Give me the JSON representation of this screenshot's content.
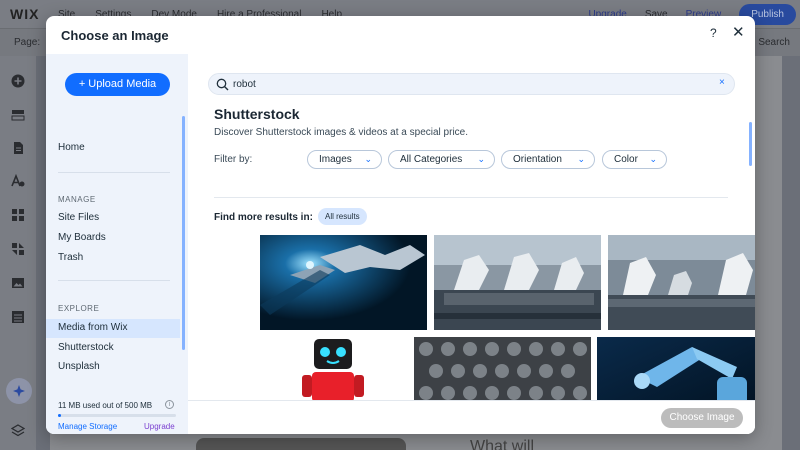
{
  "editor": {
    "logo": "WIX",
    "menu": [
      "Site",
      "Settings",
      "Dev Mode",
      "Hire a Professional",
      "Help"
    ],
    "top_right": {
      "upgrade": "Upgrade",
      "save": "Save",
      "preview": "Preview",
      "publish": "Publish"
    },
    "page_label": "Page:",
    "search_label": "Search",
    "canvas_text": "What will"
  },
  "modal": {
    "title": "Choose an Image",
    "help_glyph": "?",
    "close_glyph": "✕",
    "upload_label": "+ Upload Media",
    "sidebar": {
      "home": "Home",
      "manage_header": "MANAGE",
      "manage_items": [
        "Site Files",
        "My Boards",
        "Trash"
      ],
      "explore_header": "EXPLORE",
      "explore_items": [
        "Media from Wix",
        "Shutterstock",
        "Unsplash"
      ],
      "selected": "Shutterstock",
      "storage_text": "11 MB used out of 500 MB",
      "storage_used_fraction": 0.022,
      "manage_storage": "Manage Storage",
      "upgrade": "Upgrade",
      "info_glyph": "i"
    },
    "search": {
      "value": "robot",
      "clear_glyph": "×"
    },
    "provider": {
      "title": "Shutterstock",
      "subtitle": "Discover Shutterstock images & videos at a special price."
    },
    "filters": {
      "label": "Filter by:",
      "chips": [
        "Images",
        "All Categories",
        "Orientation",
        "Color"
      ],
      "chevron": "⌄"
    },
    "results": {
      "label": "Find more results in:",
      "all_results": "All results"
    },
    "choose_button": "Choose Image"
  },
  "colors": {
    "accent": "#116dff",
    "sidebar_bg": "#eef3fb",
    "selected_bg": "#d6e6fe",
    "upgrade_purple": "#7a3fd0",
    "disabled_button": "#bcbcbc"
  }
}
